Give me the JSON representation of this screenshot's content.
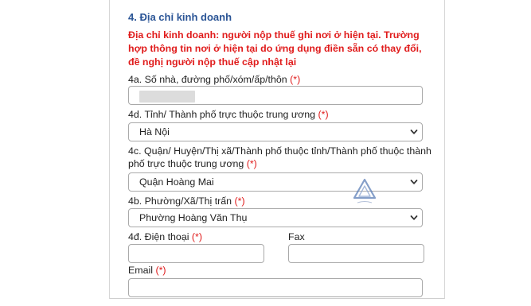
{
  "section": {
    "title": "4. Địa chỉ kinh doanh",
    "notice": "Địa chỉ kinh doanh: người nộp thuế ghi nơi ở hiện tại. Trường hợp thông tin nơi ở hiện tại do ứng dụng điền sẵn có thay đổi, đề nghị người nộp thuế cập nhật lại"
  },
  "fields": {
    "house": {
      "label": "4a. Số nhà, đường phố/xóm/ấp/thôn",
      "required": "(*)",
      "value": ""
    },
    "province": {
      "label": "4d. Tỉnh/ Thành phố trực thuộc trung ương",
      "required": "(*)",
      "value": "Hà Nội"
    },
    "district": {
      "label": "4c. Quận/ Huyện/Thị xã/Thành phố thuộc tỉnh/Thành phố thuộc thành phố trực thuộc trung ương",
      "required": "(*)",
      "value": "Quận Hoàng Mai"
    },
    "ward": {
      "label": "4b. Phường/Xã/Thị trấn",
      "required": "(*)",
      "value": "Phường Hoàng Văn Thụ"
    },
    "phone": {
      "label": "4đ. Điện thoại",
      "required": "(*)",
      "value": ""
    },
    "fax": {
      "label": "Fax",
      "value": ""
    },
    "email": {
      "label": "Email",
      "required": "(*)",
      "value": ""
    }
  },
  "icons": {
    "dropdown": "chevron-down-icon",
    "watermark": "triangle-logo-icon"
  },
  "colors": {
    "title": "#2b5596",
    "notice": "#e01b1b",
    "required": "#e01b1b",
    "border": "#a9a9a9"
  }
}
